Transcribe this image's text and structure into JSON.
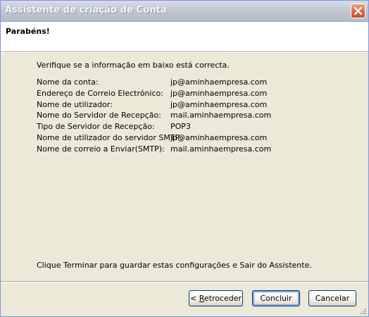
{
  "window": {
    "title": "Assistente de criação de Conta"
  },
  "header": {
    "title": "Parabéns!"
  },
  "content": {
    "intro": "Verifique se a informação em baixo está correcta.",
    "rows": [
      {
        "label": "Nome da conta:",
        "value": "jp@aminhaempresa.com"
      },
      {
        "label": "Endereço de Correio Electrónico:",
        "value": "jp@aminhaempresa.com"
      },
      {
        "label": "Nome de utilizador:",
        "value": "jp@aminhaempresa.com"
      },
      {
        "label": "Nome do Servidor de Recepção:",
        "value": "mail.aminhaempresa.com"
      },
      {
        "label": "Tipo de Servidor de Recepção:",
        "value": "POP3"
      },
      {
        "label": "Nome de utilizador do servidor SMTP:",
        "value": "jp@aminhaempresa.com"
      },
      {
        "label": "Nome de correio a Enviar(SMTP):",
        "value": "mail.aminhaempresa.com"
      }
    ],
    "footer_note": "Clique Terminar para guardar estas configurações e Sair do Assistente."
  },
  "buttons": {
    "back_prefix": "< ",
    "back_accel": "R",
    "back_rest": "etroceder",
    "finish": "Concluir",
    "cancel": "Cancelar"
  },
  "icons": {
    "close": "close-icon",
    "grip": "resize-grip-icon"
  },
  "colors": {
    "dialog_bg": "#ece9d8",
    "header_bg": "#ffffff",
    "close_button": "#d86a45",
    "default_button_focus": "#7fa3e0"
  }
}
